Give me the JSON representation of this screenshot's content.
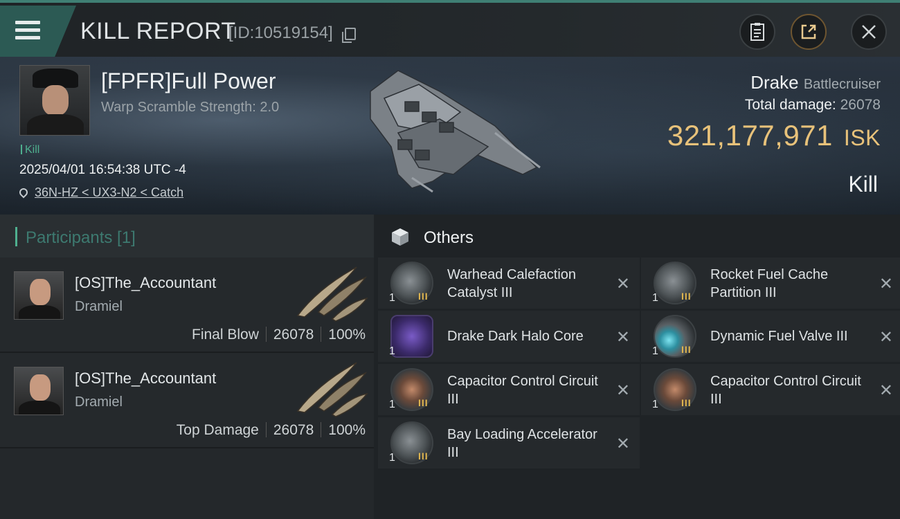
{
  "header": {
    "title": "KILL REPORT",
    "report_id": "[ID:10519154]"
  },
  "victim": {
    "name": "[FPFR]Full Power",
    "warp_scramble": "Warp Scramble Strength: 2.0",
    "tag": "Kill",
    "datetime": "2025/04/01 16:54:38 UTC -4",
    "location": "36N-HZ < UX3-N2 < Catch",
    "ship_name": "Drake",
    "ship_class": "Battlecruiser",
    "damage_label": "Total damage:",
    "total_damage": "26078",
    "isk_value": "321,177,971",
    "isk_unit": "ISK",
    "result": "Kill"
  },
  "participants": {
    "title": "Participants [1]",
    "rows": [
      {
        "name": "[OS]The_Accountant",
        "ship": "Dramiel",
        "role": "Final Blow",
        "damage": "26078",
        "percent": "100%"
      },
      {
        "name": "[OS]The_Accountant",
        "ship": "Dramiel",
        "role": "Top Damage",
        "damage": "26078",
        "percent": "100%"
      }
    ]
  },
  "others": {
    "title": "Others",
    "items": [
      {
        "name": "Warhead Calefaction Catalyst III",
        "qty": "1",
        "tier": "III",
        "icon": "rig-icon"
      },
      {
        "name": "Rocket Fuel Cache Partition III",
        "qty": "1",
        "tier": "III",
        "icon": "rig-icon"
      },
      {
        "name": "Drake Dark Halo Core",
        "qty": "1",
        "tier": "",
        "icon": "core-icon"
      },
      {
        "name": "Dynamic Fuel Valve III",
        "qty": "1",
        "tier": "III",
        "icon": "valve-icon"
      },
      {
        "name": "Capacitor Control Circuit III",
        "qty": "1",
        "tier": "III",
        "icon": "capacitor-icon"
      },
      {
        "name": "Capacitor Control Circuit III",
        "qty": "1",
        "tier": "III",
        "icon": "capacitor-icon"
      },
      {
        "name": "Bay Loading Accelerator III",
        "qty": "1",
        "tier": "III",
        "icon": "rig-icon"
      }
    ]
  },
  "icons": {
    "menu": "hamburger-menu-icon",
    "copy": "copy-icon",
    "clipboard": "clipboard-icon",
    "share": "share-icon",
    "close": "close-icon",
    "location": "map-pin-icon",
    "others": "cube-icon",
    "remove": "remove-x-icon"
  },
  "colors": {
    "accent_teal": "#4fb08f",
    "isk_gold": "#e8c27a",
    "tier_gold": "#e0b64f"
  }
}
